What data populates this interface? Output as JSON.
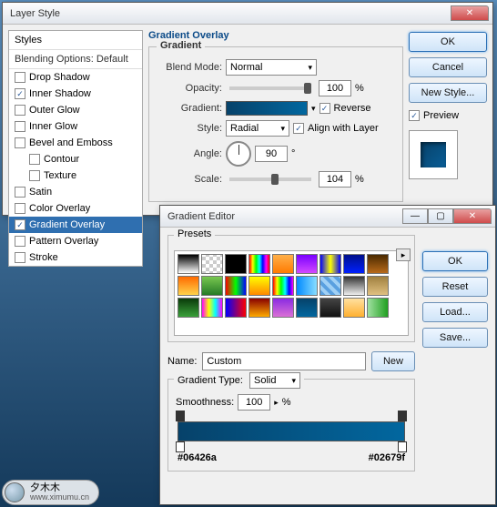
{
  "layerStyle": {
    "title": "Layer Style",
    "stylesHeader": "Styles",
    "blendingOptions": "Blending Options: Default",
    "items": [
      {
        "label": "Drop Shadow",
        "checked": false
      },
      {
        "label": "Inner Shadow",
        "checked": true
      },
      {
        "label": "Outer Glow",
        "checked": false
      },
      {
        "label": "Inner Glow",
        "checked": false
      },
      {
        "label": "Bevel and Emboss",
        "checked": false
      },
      {
        "label": "Contour",
        "checked": false,
        "indent": true
      },
      {
        "label": "Texture",
        "checked": false,
        "indent": true
      },
      {
        "label": "Satin",
        "checked": false
      },
      {
        "label": "Color Overlay",
        "checked": false
      },
      {
        "label": "Gradient Overlay",
        "checked": true,
        "selected": true
      },
      {
        "label": "Pattern Overlay",
        "checked": false
      },
      {
        "label": "Stroke",
        "checked": false
      }
    ],
    "sectionTitle": "Gradient Overlay",
    "groupTitle": "Gradient",
    "blendModeLabel": "Blend Mode:",
    "blendMode": "Normal",
    "opacityLabel": "Opacity:",
    "opacity": "100",
    "opacityUnit": "%",
    "gradientLabel": "Gradient:",
    "reverseLabel": "Reverse",
    "reverseChecked": true,
    "styleLabel": "Style:",
    "style": "Radial",
    "alignLabel": "Align with Layer",
    "alignChecked": true,
    "angleLabel": "Angle:",
    "angle": "90",
    "angleUnit": "°",
    "scaleLabel": "Scale:",
    "scale": "104",
    "scaleUnit": "%",
    "buttons": {
      "ok": "OK",
      "cancel": "Cancel",
      "newStyle": "New Style...",
      "previewLabel": "Preview",
      "previewChecked": true
    }
  },
  "gradientEditor": {
    "title": "Gradient Editor",
    "presetsLabel": "Presets",
    "presetsMenu": "▸",
    "nameLabel": "Name:",
    "name": "Custom",
    "newBtn": "New",
    "gradientTypeLabel": "Gradient Type:",
    "gradientType": "Solid",
    "smoothnessLabel": "Smoothness:",
    "smoothness": "100",
    "smoothnessUnit": "%",
    "hexLeft": "#06426a",
    "hexRight": "#02679f",
    "buttons": {
      "ok": "OK",
      "reset": "Reset",
      "load": "Load...",
      "save": "Save..."
    },
    "presets": [
      "linear-gradient(to bottom,#000,#fff)",
      "repeating-conic-gradient(#ccc 0 25%,#fff 0 50%) 0/8px 8px",
      "linear-gradient(to bottom,#000,#000)",
      "linear-gradient(to right,#f00,#ff0,#0f0,#0ff,#00f,#f0f,#f00)",
      "linear-gradient(to bottom,#ffb04a,#ff7a00)",
      "linear-gradient(to bottom,#7a00ff,#d24aff)",
      "linear-gradient(to right,#00f,#ff0,#00f)",
      "linear-gradient(to bottom,#00108a,#0020ff)",
      "linear-gradient(to bottom,#4a2a00,#b86a1a)",
      "linear-gradient(to bottom,#ff6a00,#ffd24a)",
      "linear-gradient(to bottom,#78c850,#267a26)",
      "linear-gradient(to right,#f00,#0f0,#00f)",
      "linear-gradient(to bottom,#ff0,#f80)",
      "linear-gradient(to right,#f00,#ff0,#0f0,#0ff,#00f,#f0f)",
      "linear-gradient(to right,#008aff,#88ddff)",
      "repeating-linear-gradient(45deg,#5aa0e0 0 4px,#a0d0f5 4px 8px)",
      "linear-gradient(to bottom,#333,#eee)",
      "linear-gradient(to bottom,#a08040,#e0c080)",
      "linear-gradient(to bottom,#0a3a0a,#3aa03a)",
      "linear-gradient(to right,#f0f,#ff0,#0ff,#f0f)",
      "linear-gradient(to right,#00f,#f00)",
      "linear-gradient(to bottom,#800,#fa0)",
      "linear-gradient(to bottom,#8a2be2,#da70d6)",
      "linear-gradient(to bottom,#06426a,#02679f)",
      "linear-gradient(to bottom,#444,#111)",
      "linear-gradient(to bottom,#ffe0a0,#ffb030)",
      "linear-gradient(to right,#a0e0a0,#20a020)"
    ]
  },
  "watermark": {
    "text": "夕木木",
    "url": "www.ximumu.cn"
  }
}
